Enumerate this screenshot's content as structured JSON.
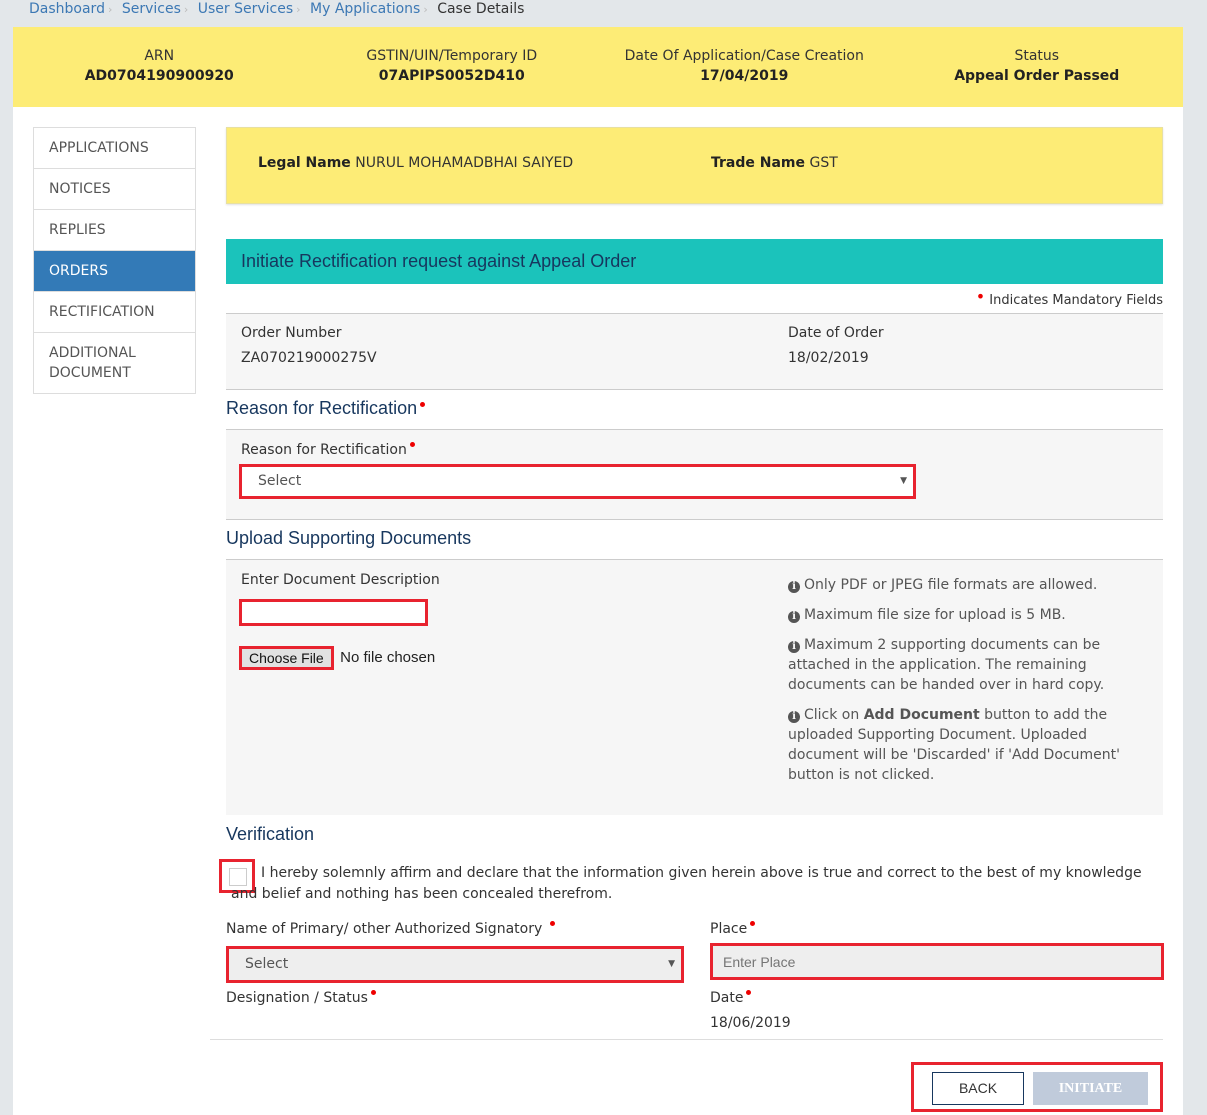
{
  "breadcrumb": {
    "items": [
      "Dashboard",
      "Services",
      "User Services",
      "My Applications"
    ],
    "current": "Case Details"
  },
  "case_header": {
    "arn_label": "ARN",
    "arn_value": "AD0704190900920",
    "gstin_label": "GSTIN/UIN/Temporary ID",
    "gstin_value": "07APIPS0052D410",
    "date_label": "Date Of Application/Case Creation",
    "date_value": "17/04/2019",
    "status_label": "Status",
    "status_value": "Appeal Order Passed"
  },
  "sidebar": {
    "items": [
      {
        "label": "APPLICATIONS",
        "active": false
      },
      {
        "label": "NOTICES",
        "active": false
      },
      {
        "label": "REPLIES",
        "active": false
      },
      {
        "label": "ORDERS",
        "active": true
      },
      {
        "label": "RECTIFICATION",
        "active": false
      },
      {
        "label": "ADDITIONAL DOCUMENT",
        "active": false
      }
    ]
  },
  "names": {
    "legal_name_label": "Legal Name",
    "legal_name_value": "NURUL MOHAMADBHAI SAIYED",
    "trade_name_label": "Trade Name",
    "trade_name_value": "GST"
  },
  "form": {
    "banner_title": "Initiate Rectification request against Appeal Order",
    "mandatory_note": "Indicates Mandatory Fields",
    "order_number_label": "Order Number",
    "order_number_value": "ZA070219000275V",
    "order_date_label": "Date of Order",
    "order_date_value": "18/02/2019",
    "reason_section_title": "Reason for Rectification",
    "reason_label": "Reason for Rectification",
    "reason_selected": "Select",
    "upload_section_title": "Upload Supporting Documents",
    "doc_desc_label": "Enter Document Description",
    "doc_desc_value": "",
    "choose_file_label": "Choose File",
    "no_file_text": "No file chosen",
    "info_notes": [
      "Only PDF or JPEG file formats are allowed.",
      "Maximum file size for upload is 5 MB.",
      "Maximum 2 supporting documents can be attached in the application. The remaining documents can be handed over in hard copy."
    ],
    "info_add_doc_prefix": "Click on",
    "info_add_doc_bold": "Add Document",
    "info_add_doc_suffix": "button to add the uploaded Supporting Document. Uploaded document will be 'Discarded' if 'Add Document' button is not clicked.",
    "verification_title": "Verification",
    "declaration_text": "I hereby solemnly affirm and declare that the information given herein above is true and correct to the best of my knowledge and belief and nothing has been concealed therefrom.",
    "declaration_checked": false,
    "signatory_label": "Name of Primary/ other Authorized Signatory",
    "signatory_selected": "Select",
    "place_label": "Place",
    "place_placeholder": "Enter Place",
    "designation_label": "Designation / Status",
    "date_label": "Date",
    "date_value": "18/06/2019"
  },
  "actions": {
    "back_label": "BACK",
    "initiate_label": "INITIATE"
  },
  "colors": {
    "header_yellow": "#fdec76",
    "banner_teal": "#1bc3bb",
    "active_blue": "#337ab7",
    "highlight_red": "#e8232f",
    "disabled_button": "#c0cbdb"
  }
}
